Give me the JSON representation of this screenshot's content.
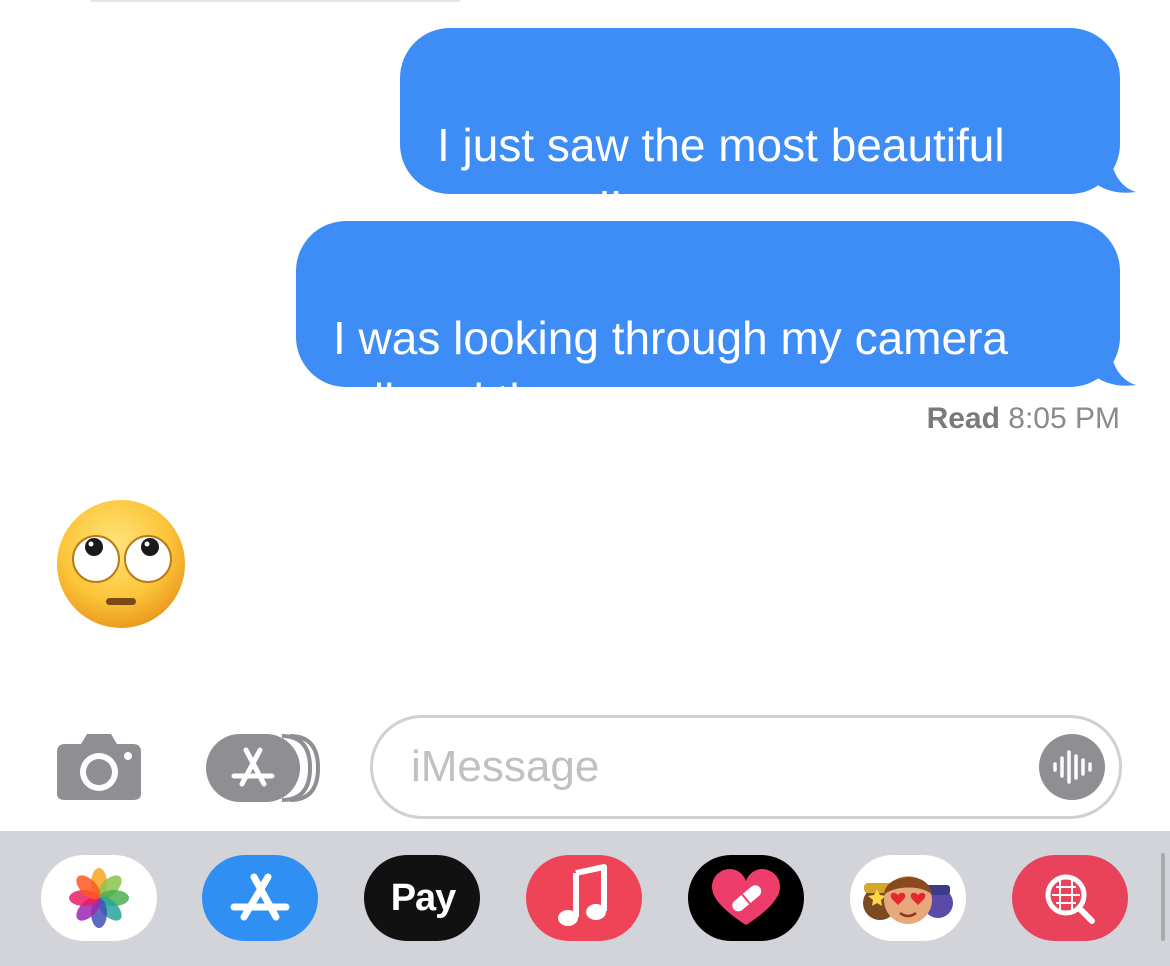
{
  "messages": [
    {
      "text": "I just saw the most beautiful\nwoman I’ve ever seen",
      "direction": "outgoing"
    },
    {
      "text": "I was looking through my camera\nroll and there you were",
      "direction": "outgoing"
    }
  ],
  "receipt": {
    "label": "Read",
    "time": "8:05 PM"
  },
  "reply": {
    "emoji": "face-with-rolling-eyes",
    "direction": "incoming"
  },
  "composer": {
    "placeholder": "iMessage",
    "camera_icon": "camera-icon",
    "apps_icon": "app-store-icon",
    "audio_icon": "waveform-icon"
  },
  "app_tray": [
    {
      "name": "Photos",
      "icon": "photos-icon"
    },
    {
      "name": "App Store",
      "icon": "app-store-icon"
    },
    {
      "name": "Apple Pay",
      "label": "Pay",
      "icon": "apple-icon"
    },
    {
      "name": "Music",
      "icon": "music-note-icon"
    },
    {
      "name": "Fitness",
      "icon": "heart-icon"
    },
    {
      "name": "Memoji",
      "icon": "memoji-icon"
    },
    {
      "name": "Images",
      "icon": "image-search-icon"
    }
  ],
  "colors": {
    "bubble_outgoing": "#3e8cf5",
    "tray_background": "#d2d4d9",
    "placeholder": "#c0c0c4"
  }
}
